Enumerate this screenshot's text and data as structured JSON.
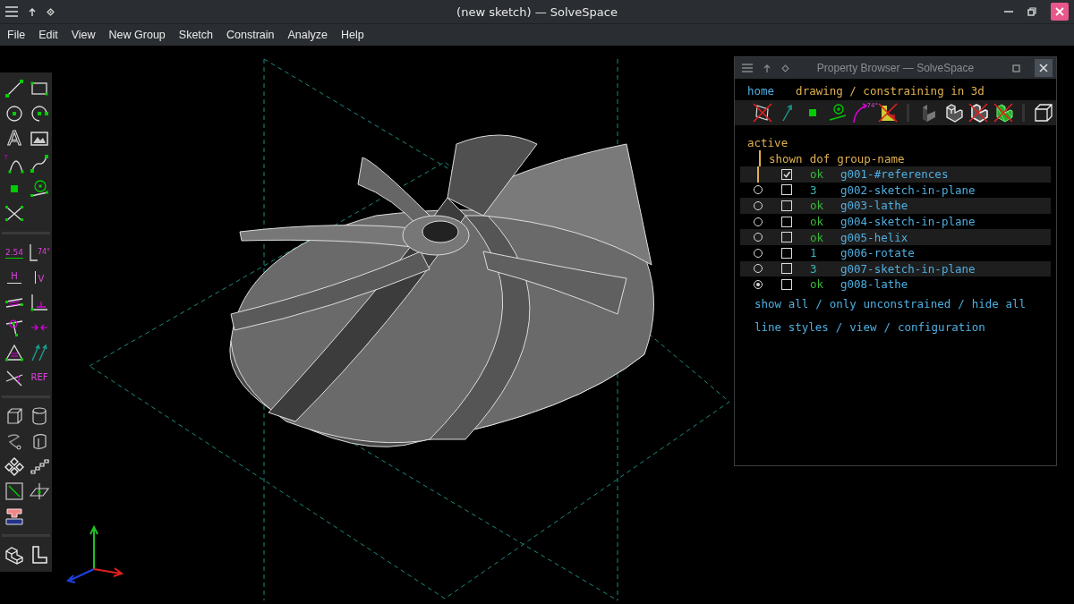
{
  "window": {
    "title": "(new sketch) — SolveSpace"
  },
  "menu": [
    "File",
    "Edit",
    "View",
    "New Group",
    "Sketch",
    "Constrain",
    "Analyze",
    "Help"
  ],
  "toolbar": [
    [
      {
        "kind": "line"
      },
      {
        "kind": "rectangle"
      },
      {
        "kind": "circle"
      },
      {
        "kind": "arc"
      },
      {
        "kind": "text",
        "label": "A"
      },
      {
        "kind": "image"
      },
      {
        "kind": "tangent-arc",
        "label": "T"
      },
      {
        "kind": "bezier"
      },
      {
        "kind": "point"
      },
      {
        "kind": "workplane"
      },
      {
        "kind": "split"
      }
    ],
    [
      {
        "kind": "distance",
        "label": "2.54"
      },
      {
        "kind": "angle",
        "label": "74°"
      },
      {
        "kind": "horizontal",
        "label": "H"
      },
      {
        "kind": "vertical",
        "label": "V"
      },
      {
        "kind": "parallel"
      },
      {
        "kind": "perpendicular"
      },
      {
        "kind": "on-entity"
      },
      {
        "kind": "symmetric"
      },
      {
        "kind": "equal"
      },
      {
        "kind": "orientation"
      },
      {
        "kind": "other-angle"
      },
      {
        "kind": "reference",
        "label": "REF"
      }
    ],
    [
      {
        "kind": "extrude"
      },
      {
        "kind": "lathe"
      },
      {
        "kind": "helix"
      },
      {
        "kind": "revolve"
      },
      {
        "kind": "step-rotate"
      },
      {
        "kind": "step-translate"
      },
      {
        "kind": "in-plane"
      },
      {
        "kind": "workplane-3d"
      },
      {
        "kind": "linked"
      }
    ],
    [
      {
        "kind": "nearest-iso"
      },
      {
        "kind": "nearest-ortho"
      }
    ]
  ],
  "browser": {
    "title": "Property Browser — SolveSpace",
    "home": "home",
    "heading": "drawing / constraining in 3d",
    "icons": [
      {
        "kind": "workplanes",
        "shown": false
      },
      {
        "kind": "normals",
        "shown": true
      },
      {
        "kind": "points",
        "shown": true
      },
      {
        "kind": "constraints",
        "shown": true
      },
      {
        "kind": "dimensions",
        "shown": true,
        "label": "74°"
      },
      {
        "kind": "faces",
        "shown": false
      },
      {
        "kind": "shaded",
        "shown": true
      },
      {
        "kind": "edges",
        "shown": true
      },
      {
        "kind": "outlines",
        "shown": false
      },
      {
        "kind": "mesh",
        "shown": false
      },
      {
        "kind": "perspective",
        "shown": true
      }
    ],
    "col_active": "active",
    "col_shown": "shown",
    "col_dof": "dof",
    "col_name": "group-name",
    "groups": [
      {
        "shown": true,
        "dof": "ok",
        "solved": true,
        "name": "g001-#references"
      },
      {
        "active": false,
        "shown": false,
        "dof": "3",
        "solved": false,
        "name": "g002-sketch-in-plane"
      },
      {
        "active": false,
        "shown": false,
        "dof": "ok",
        "solved": true,
        "name": "g003-lathe"
      },
      {
        "active": false,
        "shown": false,
        "dof": "ok",
        "solved": true,
        "name": "g004-sketch-in-plane"
      },
      {
        "active": false,
        "shown": false,
        "dof": "ok",
        "solved": true,
        "name": "g005-helix"
      },
      {
        "active": false,
        "shown": false,
        "dof": "1",
        "solved": false,
        "name": "g006-rotate"
      },
      {
        "active": false,
        "shown": false,
        "dof": "3",
        "solved": false,
        "name": "g007-sketch-in-plane"
      },
      {
        "active": true,
        "shown": false,
        "dof": "ok",
        "solved": true,
        "name": "g008-lathe"
      }
    ],
    "links1": [
      "show all",
      "only unconstrained",
      "hide all"
    ],
    "links2": [
      "line styles",
      "view",
      "configuration"
    ],
    "sep": "/"
  }
}
